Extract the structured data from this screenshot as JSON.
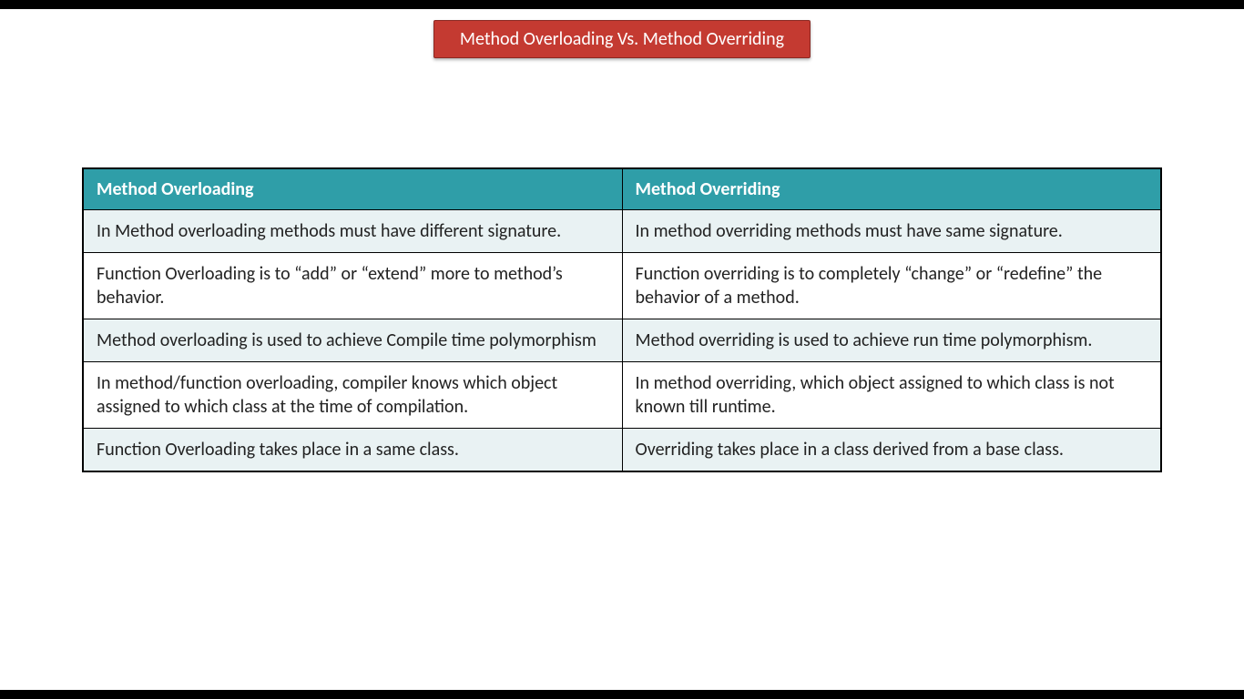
{
  "title": "Method Overloading Vs. Method Overriding",
  "table": {
    "headers": {
      "left": "Method Overloading",
      "right": "Method Overriding"
    },
    "rows": [
      {
        "left": "In Method overloading methods must have different signature.",
        "right": "In method overriding methods must have same signature."
      },
      {
        "left": "Function Overloading is to “add” or “extend” more to method’s behavior.",
        "right": "Function overriding is to completely “change” or “redefine” the behavior of a method."
      },
      {
        "left": "Method overloading is used to achieve Compile time polymorphism",
        "right": "Method overriding is used to achieve run time polymorphism."
      },
      {
        "left": "In method/function overloading, compiler knows which object assigned to which class at the time of compilation.",
        "right": "In method overriding, which object assigned to which class is not known till runtime."
      },
      {
        "left": "Function Overloading takes place in a same class.",
        "right": "Overriding takes place in a class derived from a base class."
      }
    ]
  }
}
